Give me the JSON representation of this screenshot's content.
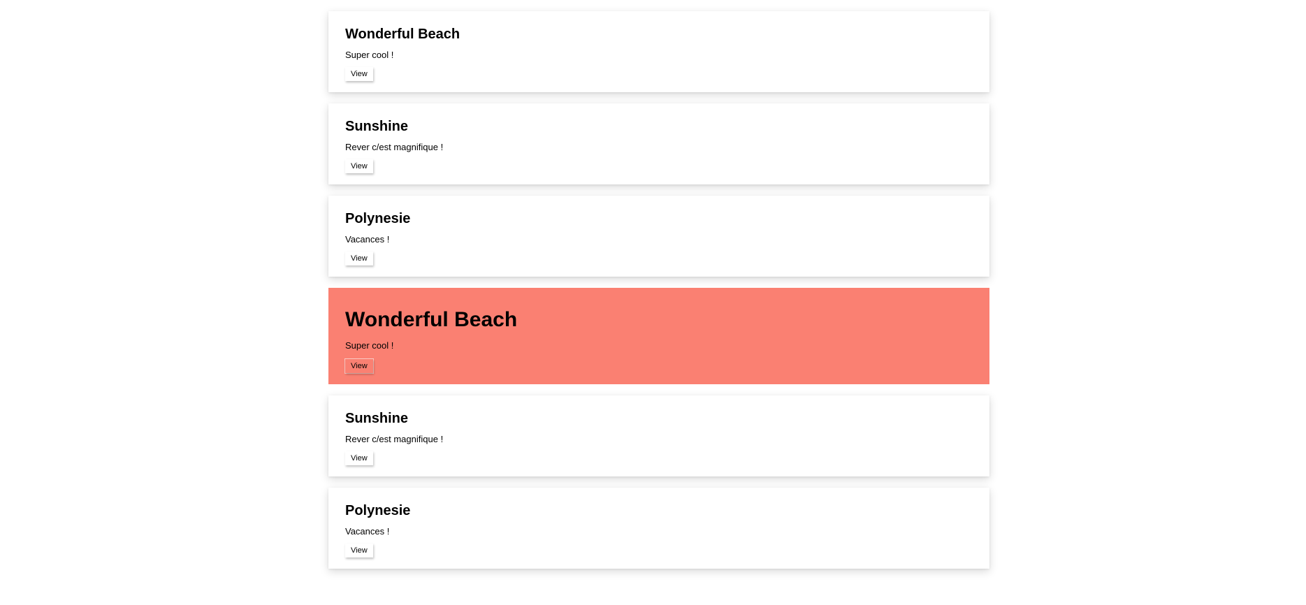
{
  "cards": [
    {
      "title": "Wonderful Beach",
      "description": "Super cool !",
      "button_label": "View"
    },
    {
      "title": "Sunshine",
      "description": "Rever c/est magnifique !",
      "button_label": "View"
    },
    {
      "title": "Polynesie",
      "description": "Vacances !",
      "button_label": "View"
    },
    {
      "title": "Wonderful Beach",
      "description": "Super cool !",
      "button_label": "View",
      "featured": true
    },
    {
      "title": "Sunshine",
      "description": "Rever c/est magnifique !",
      "button_label": "View"
    },
    {
      "title": "Polynesie",
      "description": "Vacances !",
      "button_label": "View"
    }
  ],
  "colors": {
    "featured_background": "#fa8072",
    "card_background": "#ffffff",
    "page_background": "#ffffff"
  }
}
